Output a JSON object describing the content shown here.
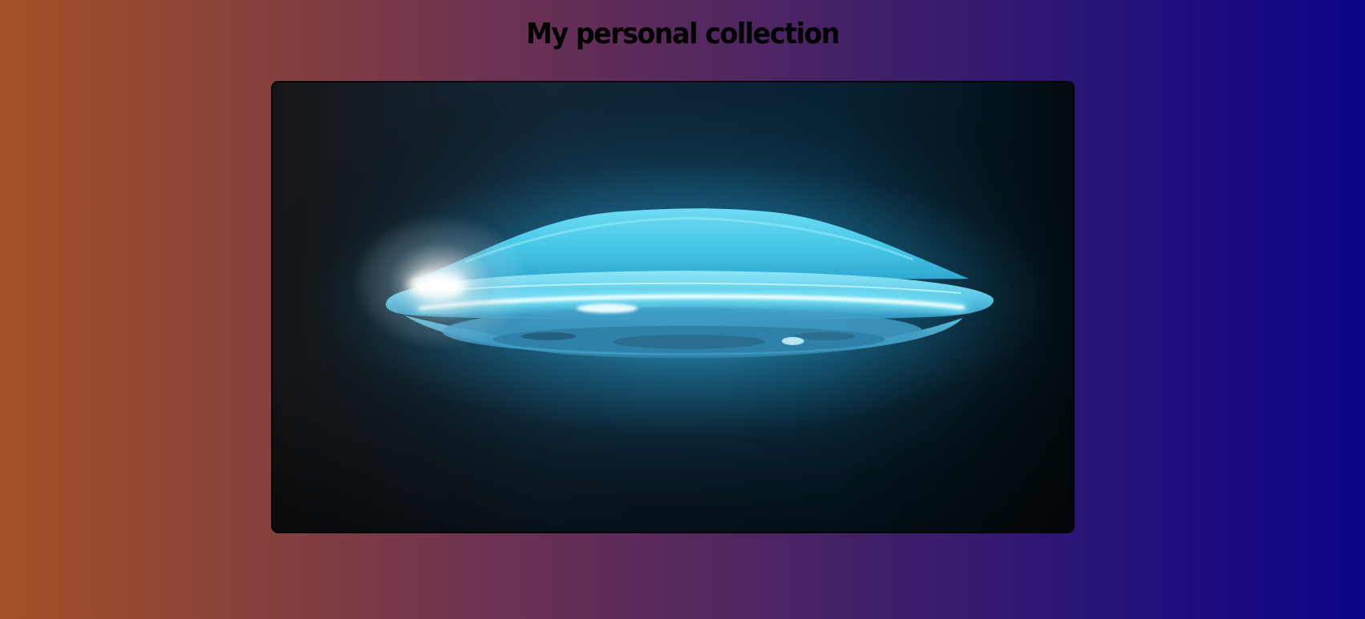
{
  "page": {
    "title": "My personal collection"
  },
  "gallery": {
    "image_subject": "flying-saucer"
  },
  "colors": {
    "background_start": "#a35126",
    "background_end": "#0c0488",
    "saucer_glow": "#4fd4f0",
    "frame_border": "#050505"
  }
}
